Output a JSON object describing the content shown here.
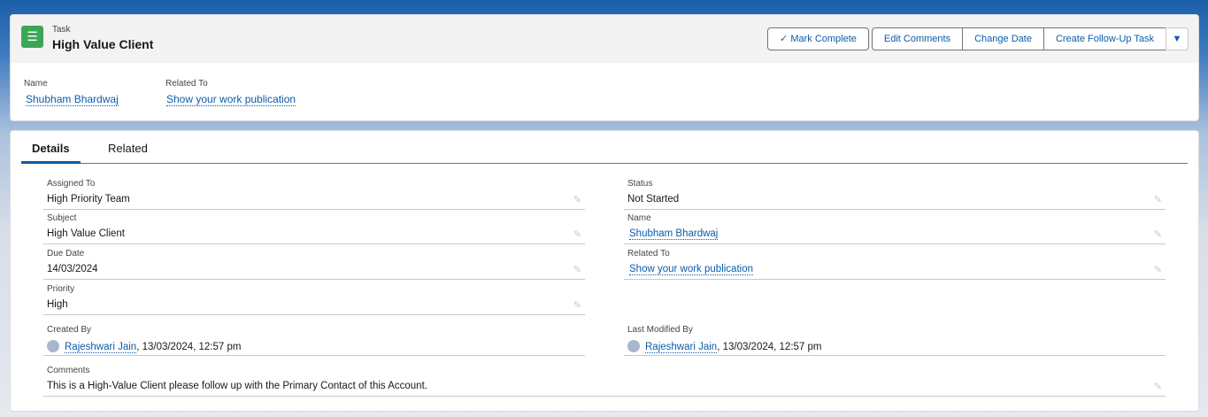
{
  "header": {
    "object_label": "Task",
    "title": "High Value Client",
    "actions": [
      "Mark Complete",
      "Edit Comments",
      "Change Date",
      "Create Follow-Up Task"
    ],
    "fields": [
      {
        "label": "Name",
        "value": "Shubham Bhardwaj"
      },
      {
        "label": "Related To",
        "value": "Show your work publication"
      }
    ]
  },
  "tabs": [
    "Details",
    "Related"
  ],
  "details": {
    "assigned_to": {
      "label": "Assigned To",
      "value": "High Priority Team"
    },
    "status": {
      "label": "Status",
      "value": "Not Started"
    },
    "subject": {
      "label": "Subject",
      "value": "High Value Client"
    },
    "name": {
      "label": "Name",
      "value": "Shubham Bhardwaj"
    },
    "due_date": {
      "label": "Due Date",
      "value": "14/03/2024"
    },
    "related_to": {
      "label": "Related To",
      "value": "Show your work publication"
    },
    "priority": {
      "label": "Priority",
      "value": "High"
    },
    "created_by": {
      "label": "Created By",
      "user": "Rajeshwari Jain",
      "when": ", 13/03/2024, 12:57 pm"
    },
    "last_modified_by": {
      "label": "Last Modified By",
      "user": "Rajeshwari Jain",
      "when": ", 13/03/2024, 12:57 pm"
    },
    "comments": {
      "label": "Comments",
      "value": "This is a High-Value Client please follow up with the Primary Contact of this Account."
    }
  }
}
